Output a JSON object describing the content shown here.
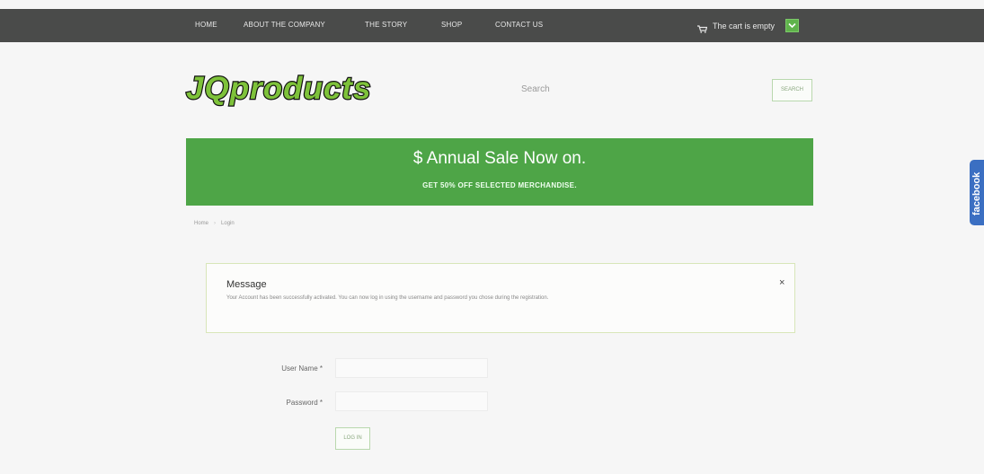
{
  "nav": {
    "items": [
      {
        "label": "HOME"
      },
      {
        "label": "ABOUT THE COMPANY"
      },
      {
        "label": "THE STORY"
      },
      {
        "label": "SHOP"
      },
      {
        "label": "CONTACT US"
      }
    ]
  },
  "cart": {
    "text": "The cart is empty",
    "icon": "shopping-cart-icon"
  },
  "logo": {
    "text": "JQproducts",
    "colors": {
      "fill": "#7ec23a",
      "outline": "#111111"
    }
  },
  "search": {
    "placeholder": "Search",
    "button_label": "SEARCH"
  },
  "banner": {
    "title": "$ Annual Sale Now on.",
    "subtitle": "GET 50% OFF SELECTED MERCHANDISE.",
    "color": "#4ea547"
  },
  "breadcrumb": {
    "items": [
      "Home",
      "Login"
    ]
  },
  "facebook": {
    "label": "facebook",
    "color": "#3b6fc2"
  },
  "message": {
    "title": "Message",
    "text": "Your Account has been successfully activated. You can now log in using the username and password you chose during the registration.",
    "close": "×"
  },
  "form": {
    "username_label": "User Name *",
    "password_label": "Password *",
    "username_value": "",
    "password_value": "",
    "login_label": "LOG IN"
  }
}
